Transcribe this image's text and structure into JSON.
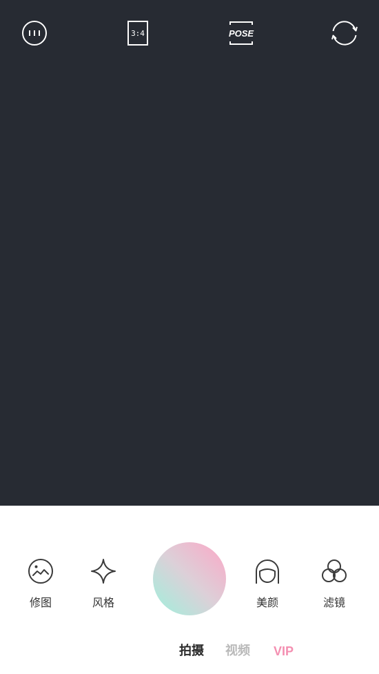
{
  "top_bar": {
    "menu_icon": "more-circle-icon",
    "ratio_label": "3:4",
    "pose_label": "POSE",
    "flip_icon": "camera-flip-icon"
  },
  "tools": {
    "edit_label": "修图",
    "style_label": "风格",
    "beauty_label": "美颜",
    "filter_label": "滤镜"
  },
  "modes": {
    "photo_label": "拍摄",
    "video_label": "视频",
    "vip_label": "VIP"
  },
  "colors": {
    "viewfinder_bg": "#272b33",
    "panel_bg": "#ffffff",
    "active_mode": "#2a2a2a",
    "inactive_mode": "#b9b9b9",
    "vip_accent": "#f48fb1",
    "shutter_pink": "#fca7c6",
    "shutter_mint": "#9ff0dc"
  }
}
